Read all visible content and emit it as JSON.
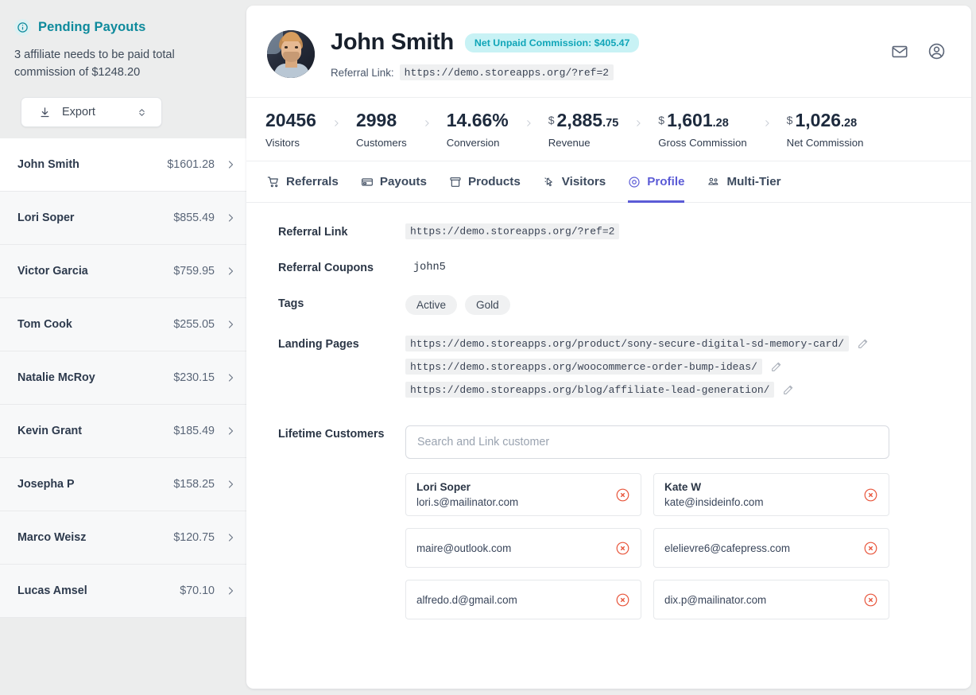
{
  "sidebar": {
    "panel_title": "Pending Payouts",
    "panel_subtitle": "3 affiliate needs to be paid total commission of $1248.20",
    "export_label": "Export",
    "info_icon": "info-circle-icon",
    "download_icon": "download-icon",
    "caret_icon": "chevron-updown-icon",
    "affiliates": [
      {
        "name": "John Smith",
        "amount": "$1601.28",
        "active": true
      },
      {
        "name": "Lori Soper",
        "amount": "$855.49",
        "active": false
      },
      {
        "name": "Victor Garcia",
        "amount": "$759.95",
        "active": false
      },
      {
        "name": "Tom Cook",
        "amount": "$255.05",
        "active": false
      },
      {
        "name": "Natalie McRoy",
        "amount": "$230.15",
        "active": false
      },
      {
        "name": "Kevin Grant",
        "amount": "$185.49",
        "active": false
      },
      {
        "name": "Josepha P",
        "amount": "$158.25",
        "active": false
      },
      {
        "name": "Marco Weisz",
        "amount": "$120.75",
        "active": false
      },
      {
        "name": "Lucas Amsel",
        "amount": "$70.10",
        "active": false
      }
    ]
  },
  "profile_header": {
    "name": "John Smith",
    "badge": "Net Unpaid Commission: $405.47",
    "referral_link_label": "Referral Link:",
    "referral_link_value": "https://demo.storeapps.org/?ref=2",
    "avatar_alt": "John Smith avatar photo",
    "mail_icon": "mail-icon",
    "account_icon": "user-circle-icon"
  },
  "stats": [
    {
      "value": "20456",
      "currency": "",
      "decimal": "",
      "label": "Visitors"
    },
    {
      "value": "2998",
      "currency": "",
      "decimal": "",
      "label": "Customers"
    },
    {
      "value": "14.66%",
      "currency": "",
      "decimal": "",
      "label": "Conversion"
    },
    {
      "value": "2,885",
      "currency": "$",
      "decimal": ".75",
      "label": "Revenue"
    },
    {
      "value": "1,601",
      "currency": "$",
      "decimal": ".28",
      "label": "Gross Commission"
    },
    {
      "value": "1,026",
      "currency": "$",
      "decimal": ".28",
      "label": "Net Commission"
    }
  ],
  "tabs": [
    {
      "label": "Referrals",
      "icon": "cart-icon",
      "active": false
    },
    {
      "label": "Payouts",
      "icon": "card-icon",
      "active": false
    },
    {
      "label": "Products",
      "icon": "box-icon",
      "active": false
    },
    {
      "label": "Visitors",
      "icon": "cursor-icon",
      "active": false
    },
    {
      "label": "Profile",
      "icon": "target-icon",
      "active": true
    },
    {
      "label": "Multi-Tier",
      "icon": "people-icon",
      "active": false
    }
  ],
  "profile": {
    "referral_link_label": "Referral Link",
    "referral_link_value": "https://demo.storeapps.org/?ref=2",
    "referral_coupons_label": "Referral Coupons",
    "referral_coupons_value": "john5",
    "tags_label": "Tags",
    "tags": [
      "Active",
      "Gold"
    ],
    "landing_pages_label": "Landing Pages",
    "landing_pages": [
      "https://demo.storeapps.org/product/sony-secure-digital-sd-memory-card/",
      "https://demo.storeapps.org/woocommerce-order-bump-ideas/",
      "https://demo.storeapps.org/blog/affiliate-lead-generation/"
    ],
    "edit_icon": "edit-pencil-icon",
    "lifetime_customers_label": "Lifetime Customers",
    "search_placeholder": "Search and Link customer",
    "search_value": "",
    "remove_icon": "remove-circle-icon",
    "customers": [
      {
        "name": "Lori Soper",
        "email": "lori.s@mailinator.com"
      },
      {
        "name": "Kate W",
        "email": "kate@insideinfo.com"
      },
      {
        "name": "",
        "email": "maire@outlook.com"
      },
      {
        "name": "",
        "email": "elelievre6@cafepress.com"
      },
      {
        "name": "",
        "email": "alfredo.d@gmail.com"
      },
      {
        "name": "",
        "email": "dix.p@mailinator.com"
      }
    ]
  },
  "colors": {
    "accent_teal": "#0e8a9c",
    "badge_bg": "#c8f2f5",
    "badge_text": "#10a5b8",
    "tab_active": "#5b5bd6",
    "remove_red": "#e8543a",
    "page_bg": "#eceded"
  }
}
